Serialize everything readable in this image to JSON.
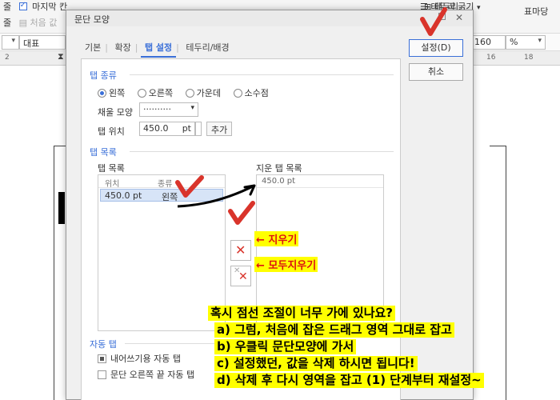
{
  "toolbar": {
    "row1": "마지막 칸",
    "row1_prefix": "줄",
    "row2": "처음 값",
    "row2_prefix": "줄",
    "border": "테두리",
    "border_width": "테두리 굵기",
    "table_style": "표마당"
  },
  "format_bar": {
    "style_value": "대표",
    "zoom_value": "160",
    "zoom_unit": "%"
  },
  "ruler": {
    "left_num": "2",
    "right_nums": [
      "16",
      "18"
    ]
  },
  "dialog": {
    "title": "문단 모양",
    "tabs": [
      "기본",
      "확장",
      "탭 설정",
      "테두리/배경"
    ],
    "active_tab": "탭 설정",
    "tab_kind": {
      "label": "탭 종류",
      "options": [
        "왼쪽",
        "오른쪽",
        "가운데",
        "소수점"
      ],
      "selected": "왼쪽"
    },
    "fill": {
      "label": "채울 모양",
      "value": "··········"
    },
    "tab_pos": {
      "label": "탭 위치",
      "value": "450.0",
      "unit": "pt",
      "add_label": "추가"
    },
    "tab_list": {
      "label": "탭 목록",
      "sub_label": "탭 목록",
      "col_pos": "위치",
      "col_kind": "종류",
      "row_pos": "450.0 pt",
      "row_kind": "왼쪽"
    },
    "deleted_list": {
      "label": "지운 탭 목록",
      "item": "450.0 pt"
    },
    "auto_tab": {
      "label": "자동 탭",
      "items": [
        {
          "label": "내어쓰기용 자동 탭",
          "checked": true
        },
        {
          "label": "문단 오른쪽 끝 자동 탭",
          "checked": false
        }
      ]
    },
    "ok_label": "설정(D)",
    "cancel_label": "취소"
  },
  "annotations": {
    "delete": "← 지우기",
    "delete_all": "← 모두지우기",
    "notes": [
      "혹시 점선 조절이 너무 가에 있나요?",
      "a) 그럼, 처음에 잡은 드래그 영역 그대로 잡고",
      "b) 우클릭 문단모양에 가서",
      "c) 설정했던, 값을 삭제 하시면 됩니다!",
      "d) 삭제 후 다시 영역을 잡고 (1) 단계부터 재설정~"
    ],
    "check_color": "#d9342b"
  }
}
